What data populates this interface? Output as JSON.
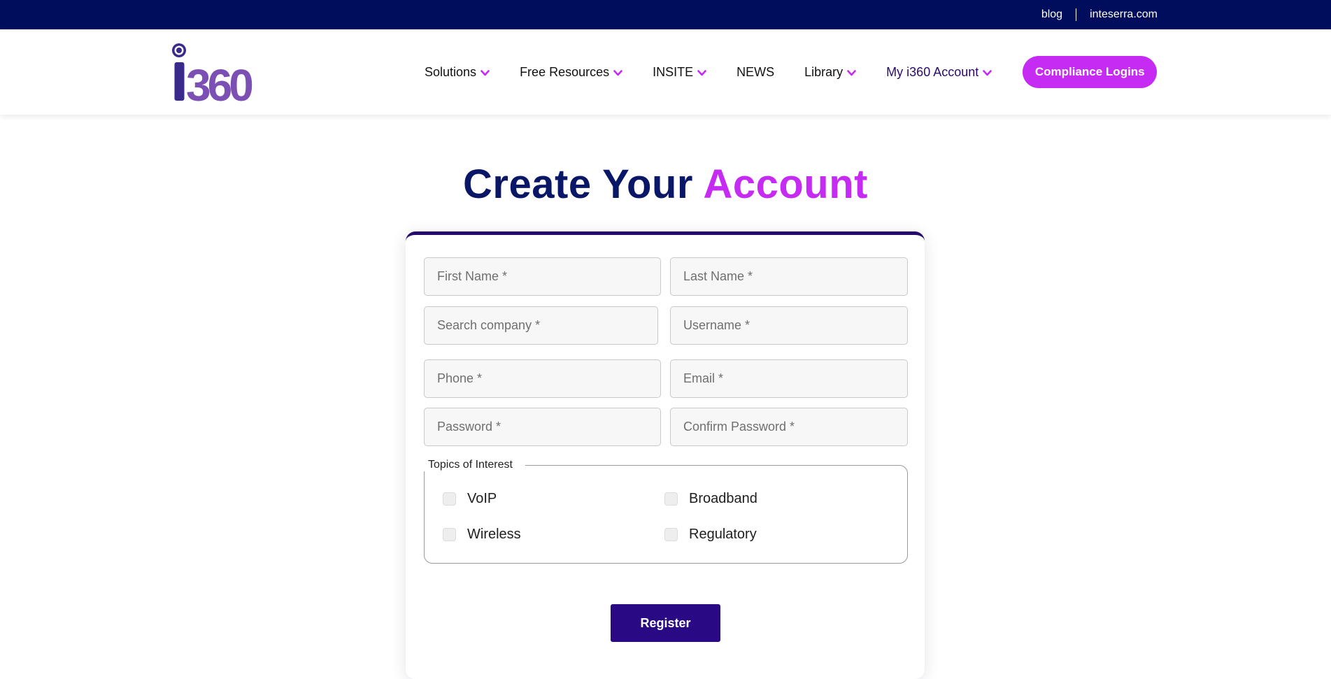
{
  "topbar": {
    "links": [
      "blog",
      "inteserra.com"
    ]
  },
  "logo": {
    "text": "i360",
    "colors": {
      "i": "#3a2a8c",
      "digits": "#7b4fb3"
    }
  },
  "nav": {
    "items": [
      {
        "label": "Solutions",
        "has_dropdown": true
      },
      {
        "label": "Free Resources",
        "has_dropdown": true
      },
      {
        "label": "INSITE",
        "has_dropdown": true
      },
      {
        "label": "NEWS",
        "has_dropdown": false
      },
      {
        "label": "Library",
        "has_dropdown": true
      },
      {
        "label": "My i360 Account",
        "has_dropdown": true
      }
    ],
    "cta_label": "Compliance Logins"
  },
  "title": {
    "main": "Create Your ",
    "highlight": "Account"
  },
  "form": {
    "placeholders": {
      "first_name": "First Name *",
      "last_name": "Last Name *",
      "company": "Search company *",
      "username": "Username *",
      "phone": "Phone *",
      "email": "Email *",
      "password": "Password *",
      "confirm_password": "Confirm Password *"
    },
    "topics": {
      "legend": "Topics of Interest",
      "options": [
        "VoIP",
        "Broadband",
        "Wireless",
        "Regulatory"
      ]
    },
    "submit_label": "Register"
  },
  "colors": {
    "topbar": "#000c5c",
    "accent": "#c52bf2",
    "title": "#0a1766",
    "register": "#2a0a84"
  }
}
